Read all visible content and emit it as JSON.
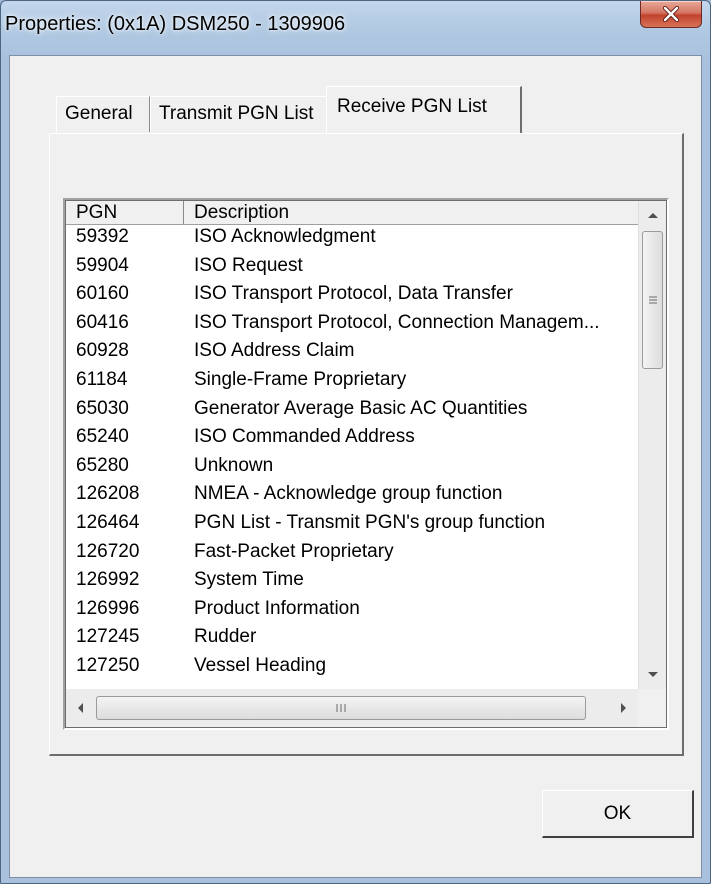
{
  "window": {
    "title": "Properties: (0x1A) DSM250 - 1309906"
  },
  "tabs": [
    {
      "label": "General"
    },
    {
      "label": "Transmit PGN List"
    },
    {
      "label": "Receive PGN List"
    }
  ],
  "list": {
    "columns": {
      "pgn": "PGN",
      "description": "Description"
    },
    "rows": [
      {
        "pgn": "59392",
        "description": "ISO Acknowledgment"
      },
      {
        "pgn": "59904",
        "description": "ISO Request"
      },
      {
        "pgn": "60160",
        "description": "ISO Transport Protocol, Data Transfer"
      },
      {
        "pgn": "60416",
        "description": "ISO Transport Protocol, Connection Managem..."
      },
      {
        "pgn": "60928",
        "description": "ISO Address Claim"
      },
      {
        "pgn": "61184",
        "description": "Single-Frame Proprietary"
      },
      {
        "pgn": "65030",
        "description": "Generator Average Basic AC Quantities"
      },
      {
        "pgn": "65240",
        "description": "ISO Commanded Address"
      },
      {
        "pgn": "65280",
        "description": "Unknown"
      },
      {
        "pgn": "126208",
        "description": "NMEA  - Acknowledge group function"
      },
      {
        "pgn": "126464",
        "description": "PGN List - Transmit PGN's group function"
      },
      {
        "pgn": "126720",
        "description": "Fast-Packet Proprietary"
      },
      {
        "pgn": "126992",
        "description": "System Time"
      },
      {
        "pgn": "126996",
        "description": "Product Information"
      },
      {
        "pgn": "127245",
        "description": "Rudder"
      },
      {
        "pgn": "127250",
        "description": "Vessel Heading"
      }
    ]
  },
  "buttons": {
    "ok": "OK"
  }
}
